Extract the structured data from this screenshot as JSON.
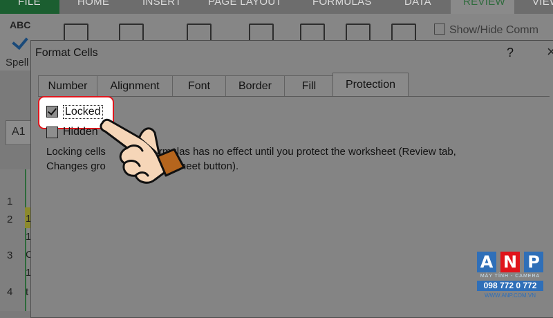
{
  "ribbon": {
    "tabs": [
      "FILE",
      "HOME",
      "INSERT",
      "PAGE LAYOUT",
      "FORMULAS",
      "DATA",
      "REVIEW",
      "VIEW"
    ],
    "abc_label": "ABC",
    "spelling_label": "Spell",
    "show_hide_label": "Show/Hide Comm"
  },
  "namebox": {
    "value": "A1"
  },
  "row_numbers": [
    "1",
    "2",
    "3",
    "4"
  ],
  "col_a_chars": [
    "1",
    "1",
    "C",
    "1",
    "t"
  ],
  "dialog": {
    "title": "Format Cells",
    "help": "?",
    "close": "×",
    "tabs": [
      "Number",
      "Alignment",
      "Font",
      "Border",
      "Fill",
      "Protection"
    ],
    "active_tab": "Protection",
    "locked": {
      "label": "Locked",
      "checked": true
    },
    "hidden": {
      "label": "Hidden",
      "checked": false
    },
    "description_line1": "Locking cells",
    "description_line1_end": "g formulas has no effect until you protect the worksheet (Review tab,",
    "description_line2": "Changes gro",
    "description_line2_end": "Sheet button)."
  },
  "logo": {
    "letters": [
      "A",
      "N",
      "P"
    ],
    "letter_colors": [
      "#2f6fb8",
      "#e0141b",
      "#2f6fb8"
    ],
    "subtitle": "MÁY TÍNH - CAMERA",
    "phone": "098 772 0 772",
    "website": "WWW.ANP.COM.VN"
  },
  "colors": {
    "highlight_border": "#e0141b",
    "hand_cuff": "#b5651d"
  }
}
